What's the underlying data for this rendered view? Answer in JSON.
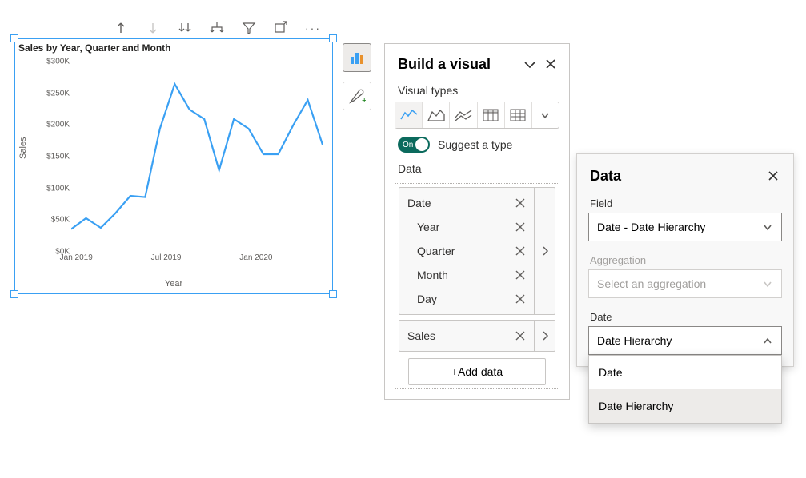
{
  "chart": {
    "title": "Sales by Year, Quarter and Month",
    "y_axis_label": "Sales",
    "x_axis_label": "Year"
  },
  "chart_data": {
    "type": "line",
    "xlabel": "Year",
    "ylabel": "Sales",
    "ylim": [
      0,
      300000
    ],
    "y_ticks": [
      "$300K",
      "$250K",
      "$200K",
      "$150K",
      "$100K",
      "$50K",
      "$0K"
    ],
    "x_ticks": [
      "Jan 2019",
      "Jul 2019",
      "Jan 2020"
    ],
    "x": [
      "Jan 2019",
      "Feb 2019",
      "Mar 2019",
      "Apr 2019",
      "May 2019",
      "Jun 2019",
      "Jul 2019",
      "Aug 2019",
      "Sep 2019",
      "Oct 2019",
      "Nov 2019",
      "Dec 2019",
      "Jan 2020",
      "Feb 2020",
      "Mar 2020",
      "Apr 2020",
      "May 2020",
      "Jun 2020"
    ],
    "values": [
      38000,
      55000,
      40000,
      63000,
      90000,
      88000,
      195000,
      265000,
      225000,
      210000,
      130000,
      210000,
      195000,
      155000,
      155000,
      200000,
      240000,
      170000
    ],
    "series_color": "#3aa0f3"
  },
  "build_panel": {
    "title": "Build a visual",
    "visual_types_label": "Visual types",
    "suggest_toggle_label": "On",
    "suggest_label": "Suggest a type",
    "data_label": "Data",
    "date_field": {
      "name": "Date",
      "children": [
        "Year",
        "Quarter",
        "Month",
        "Day"
      ]
    },
    "sales_field": "Sales",
    "add_data_label": "+Add data"
  },
  "data_panel": {
    "title": "Data",
    "field_label": "Field",
    "field_value": "Date - Date Hierarchy",
    "aggregation_label": "Aggregation",
    "aggregation_placeholder": "Select an aggregation",
    "date_label": "Date",
    "date_value": "Date Hierarchy",
    "menu_options": [
      "Date",
      "Date Hierarchy"
    ]
  }
}
